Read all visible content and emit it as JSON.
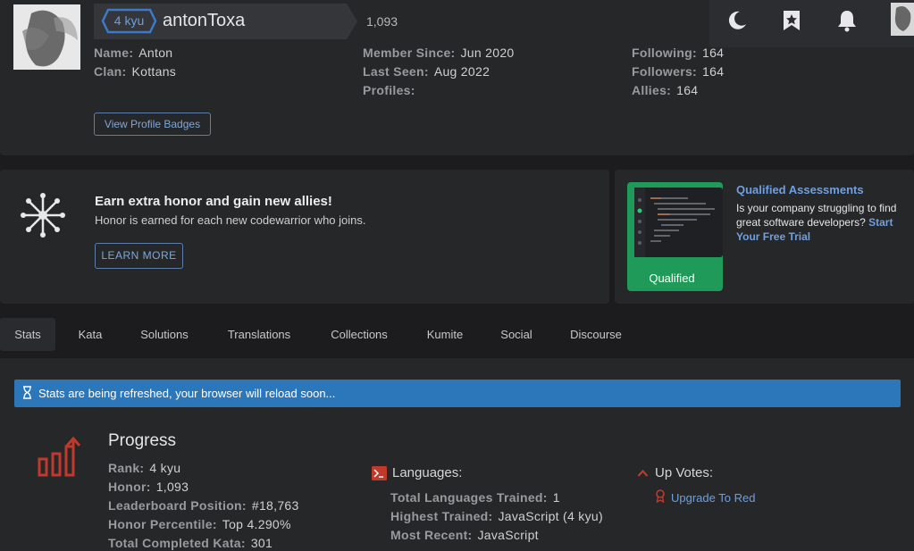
{
  "profile": {
    "rank_badge": "4 kyu",
    "username": "antonToxa",
    "honor": "1,093",
    "col1": [
      {
        "key": "Name:",
        "value": "Anton"
      },
      {
        "key": "Clan:",
        "value": "Kottans"
      }
    ],
    "col2": [
      {
        "key": "Member Since:",
        "value": "Jun 2020"
      },
      {
        "key": "Last Seen:",
        "value": "Aug 2022"
      },
      {
        "key": "Profiles:",
        "value": ""
      }
    ],
    "col3": [
      {
        "key": "Following:",
        "value": "164"
      },
      {
        "key": "Followers:",
        "value": "164"
      },
      {
        "key": "Allies:",
        "value": "164"
      }
    ],
    "badges_button": "View Profile Badges"
  },
  "topnav": {
    "icons": [
      "moon-icon",
      "bookmark-star-icon",
      "bell-icon"
    ]
  },
  "promo": {
    "title": "Earn extra honor and gain new allies!",
    "subtitle": "Honor is earned for each new codewarrior who joins.",
    "button": "LEARN MORE"
  },
  "ad": {
    "title": "Qualified Assessments",
    "text": "Is your company struggling to find great software developers?",
    "link": "Start Your Free Trial",
    "brand": "Qualified"
  },
  "tabs": [
    "Stats",
    "Kata",
    "Solutions",
    "Translations",
    "Collections",
    "Kumite",
    "Social",
    "Discourse"
  ],
  "stats": {
    "refresh_notice": "Stats are being refreshed, your browser will reload soon...",
    "progress": {
      "title": "Progress",
      "rows": [
        {
          "key": "Rank:",
          "value": "4 kyu"
        },
        {
          "key": "Honor:",
          "value": "1,093"
        },
        {
          "key": "Leaderboard Position:",
          "value": "#18,763"
        },
        {
          "key": "Honor Percentile:",
          "value": "Top 4.290%"
        },
        {
          "key": "Total Completed Kata:",
          "value": "301"
        }
      ]
    },
    "languages": {
      "title": "Languages:",
      "rows": [
        {
          "key": "Total Languages Trained:",
          "value": "1"
        },
        {
          "key": "Highest Trained:",
          "value": "JavaScript (4 kyu)"
        },
        {
          "key": "Most Recent:",
          "value": "JavaScript"
        }
      ]
    },
    "upvotes": {
      "title": "Up Votes:",
      "link": "Upgrade To Red"
    }
  },
  "colors": {
    "accent_blue": "#6f9fe0",
    "notice_blue": "#2b77ba",
    "stat_red": "#c0392b",
    "qualified_green": "#1f9a58"
  }
}
